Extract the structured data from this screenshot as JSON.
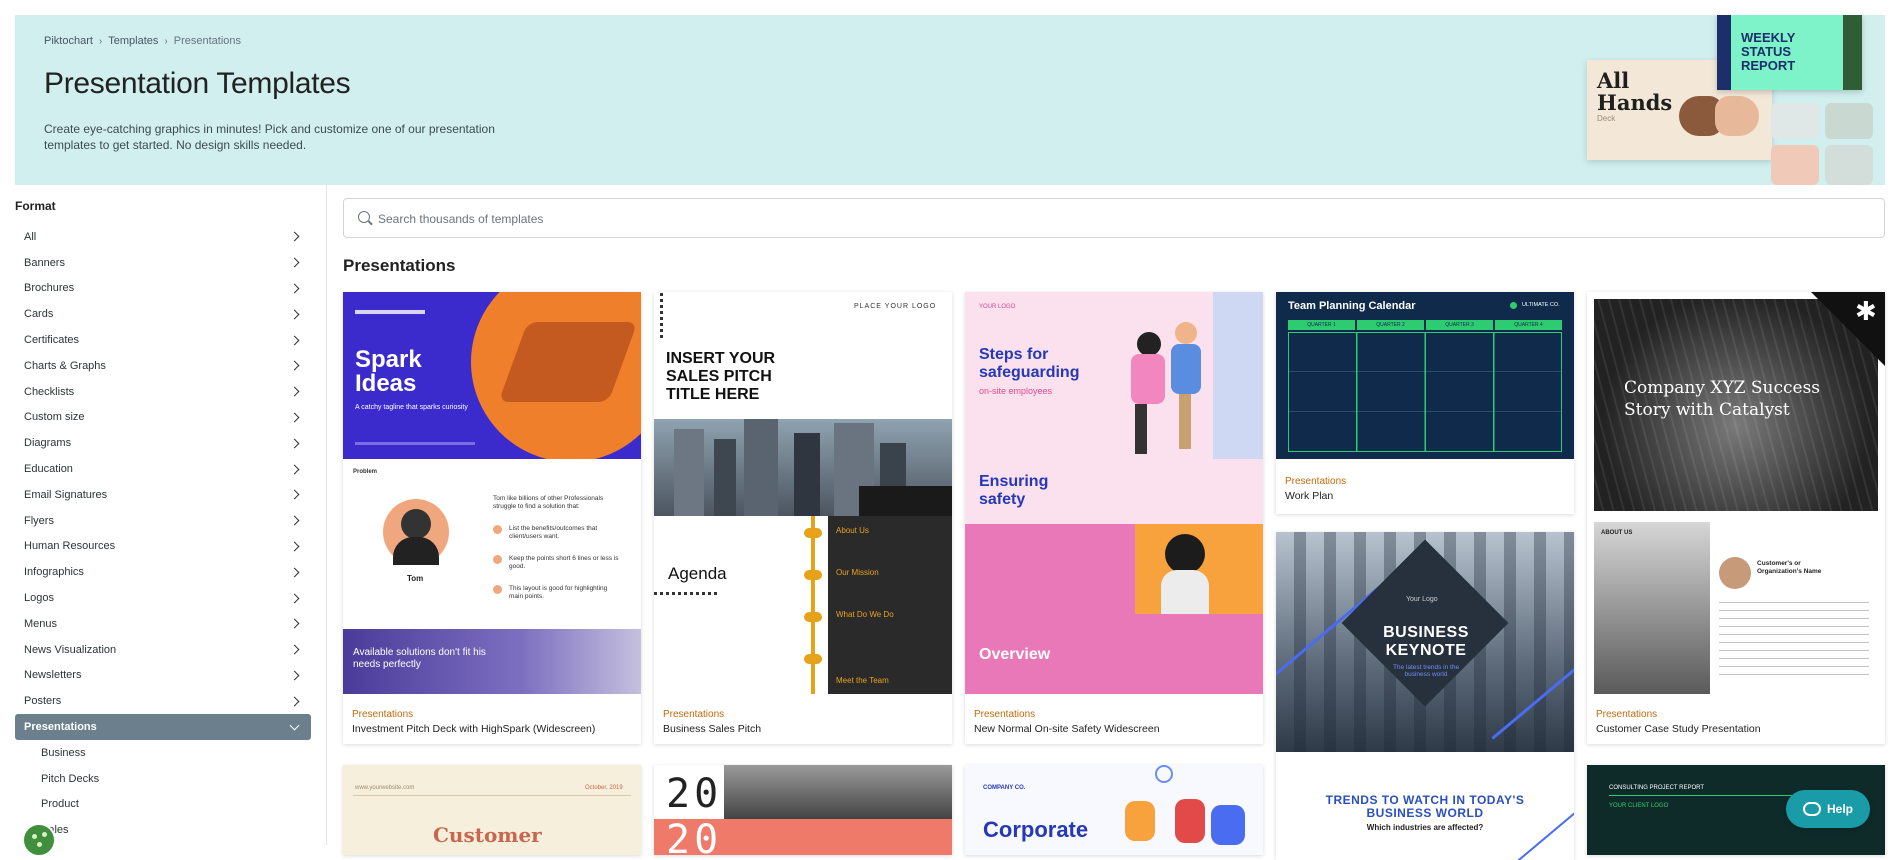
{
  "breadcrumb": {
    "home": "Piktochart",
    "section": "Templates",
    "current": "Presentations"
  },
  "hero": {
    "title": "Presentation Templates",
    "description": "Create eye-catching graphics in minutes! Pick and customize one of our presentation templates to get started. No design skills needed.",
    "art_allhands_title": "All Hands",
    "art_allhands_sub": "Deck",
    "art_weekly": "WEEKLY STATUS REPORT"
  },
  "sidebar": {
    "heading": "Format",
    "items": [
      "All",
      "Banners",
      "Brochures",
      "Cards",
      "Certificates",
      "Charts & Graphs",
      "Checklists",
      "Custom size",
      "Diagrams",
      "Education",
      "Email Signatures",
      "Flyers",
      "Human Resources",
      "Infographics",
      "Logos",
      "Menus",
      "News Visualization",
      "Newsletters",
      "Posters"
    ],
    "active": "Presentations",
    "sub_items": [
      "Business",
      "Pitch Decks",
      "Product",
      "Sales"
    ]
  },
  "search": {
    "placeholder": "Search thousands of templates"
  },
  "section_title": "Presentations",
  "cards": [
    {
      "category": "Presentations",
      "name": "Investment Pitch Deck with HighSpark (Widescreen)"
    },
    {
      "category": "Presentations",
      "name": "Business Sales Pitch"
    },
    {
      "category": "Presentations",
      "name": "New Normal On-site Safety Widescreen"
    },
    {
      "category": "Presentations",
      "name": "Work Plan"
    },
    {
      "category": "Presentations",
      "name": "Customer Case Study Presentation"
    }
  ],
  "thumbs": {
    "spark_title": "Spark Ideas",
    "spark_tag": "A catchy tagline that sparks curiosity",
    "spark_problem": "Problem",
    "spark_name": "Tom",
    "spark_point1": "Tom like billions of other Professionals struggle to find a solution that:",
    "spark_point2": "List the benefits/outcomes that client/users want.",
    "spark_point3": "Keep the points short 6 lines or less is good.",
    "spark_point4": "This layout is good for highlighting main points.",
    "spark_bottom": "Available solutions don't fit his needs perfectly",
    "sales_logo": "PLACE YOUR LOGO",
    "sales_title": "INSERT YOUR SALES PITCH TITLE HERE",
    "sales_agenda": "Agenda",
    "sales_about": "About Us",
    "sales_mission": "Our Mission",
    "sales_what": "What Do We Do",
    "sales_team": "Meet the Team",
    "safety_logo": "YOUR LOGO",
    "safety_title": "Steps for safeguarding",
    "safety_sub": "on-site employees",
    "safety_ensuring": "Ensuring safety",
    "safety_overview": "Overview",
    "plan_title": "Team Planning Calendar",
    "plan_co": "ULTIMATE CO.",
    "plan_quarters": [
      "QUARTER 1",
      "QUARTER 2",
      "QUARTER 3",
      "QUARTER 4"
    ],
    "keynote_title": "BUSINESS KEYNOTE",
    "keynote_sub": "The latest trends in the business world",
    "keynote_logo": "Your Logo",
    "case_title": "Company XYZ Success Story with Catalyst",
    "case_about": "ABOUT US",
    "case_customer": "Customer's or Organization's Name",
    "r3_customer": "Customer",
    "r3_web": "www.yourwebsite.com",
    "r3_date": "October, 2019",
    "r3_year": "20",
    "r3_co": "COMPANY CO.",
    "r3_corporate": "Corporate",
    "r3_trends": "TRENDS TO WATCH IN TODAY'S BUSINESS WORLD",
    "r3_which": "Which industries are affected?",
    "r3_consult": "CONSULTING PROJECT REPORT",
    "r3_client": "YOUR CLIENT LOGO"
  },
  "help": {
    "label": "Help"
  },
  "colors": {
    "hero_bg": "#d0efee",
    "active_nav": "#6b7f8c",
    "category": "#c36a0c",
    "help": "#1a9ca8"
  }
}
